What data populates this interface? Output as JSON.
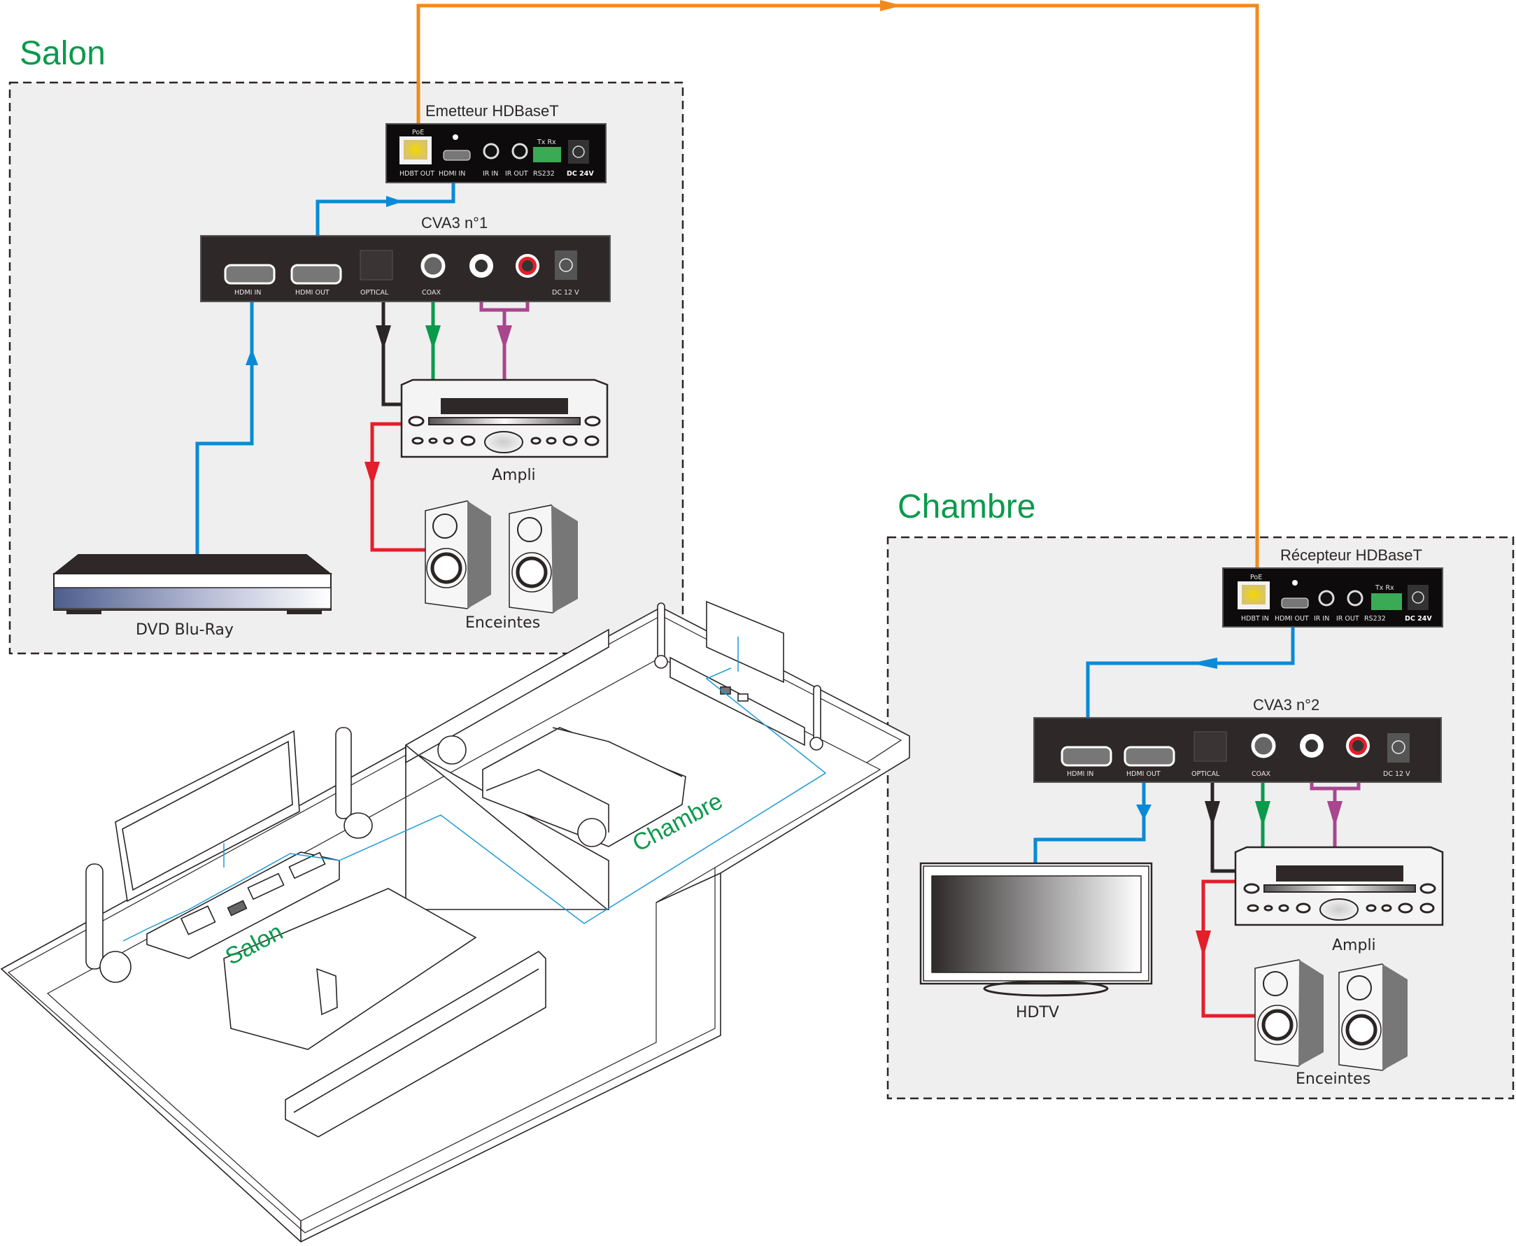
{
  "zones": {
    "salon": {
      "title": "Salon"
    },
    "chambre": {
      "title": "Chambre"
    }
  },
  "devices": {
    "emetteur": {
      "title": "Emetteur HDBaseT",
      "ports": {
        "hdbt": "HDBT OUT",
        "hdmi": "HDMI IN",
        "ir_in": "IR IN",
        "ir_out": "IR OUT",
        "rs232": "RS232",
        "dc": "DC 24V",
        "poe": "PoE",
        "txrx": "Tx  Rx"
      }
    },
    "recepteur": {
      "title": "Récepteur HDBaseT",
      "ports": {
        "hdbt": "HDBT IN",
        "hdmi": "HDMI OUT",
        "ir_in": "IR IN",
        "ir_out": "IR OUT",
        "rs232": "RS232",
        "dc": "DC 24V",
        "poe": "PoE",
        "txrx": "Tx  Rx"
      }
    },
    "cva1": {
      "title": "CVA3 n°1",
      "ports": {
        "hdmi_in": "HDMI IN",
        "hdmi_out": "HDMI OUT",
        "optical": "OPTICAL",
        "coax": "COAX",
        "dc": "DC 12 V"
      }
    },
    "cva2": {
      "title": "CVA3 n°2",
      "ports": {
        "hdmi_in": "HDMI IN",
        "hdmi_out": "HDMI OUT",
        "optical": "OPTICAL",
        "coax": "COAX",
        "dc": "DC 12 V"
      }
    },
    "ampli1": {
      "label": "Ampli"
    },
    "ampli2": {
      "label": "Ampli"
    },
    "speakers1": {
      "label": "Enceintes"
    },
    "speakers2": {
      "label": "Enceintes"
    },
    "dvd": {
      "label": "DVD Blu-Ray"
    },
    "hdtv": {
      "label": "HDTV"
    }
  },
  "floorplan": {
    "salon_label": "Salon",
    "chambre_label": "Chambre"
  },
  "colors": {
    "hdbaset_cable": "#f08a1e",
    "hdmi_cable": "#0a8ad6",
    "optical_cable": "#2b2525",
    "coax_cable": "#0a9a4c",
    "analog_cable": "#a8468e",
    "speaker_cable": "#e41e2a",
    "zone_title": "#0a9a4c"
  }
}
